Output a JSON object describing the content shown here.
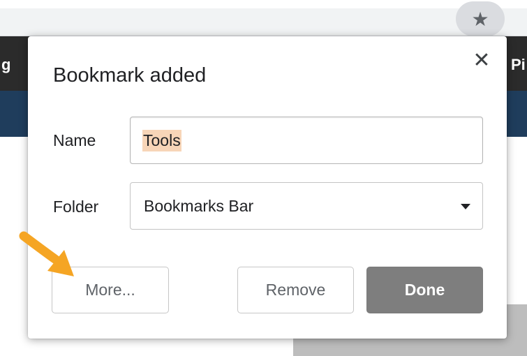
{
  "browser": {
    "bookmarks_bar_left_fragment": "g",
    "bookmarks_bar_right_fragment": "Pi",
    "star_icon": "star-icon"
  },
  "dialog": {
    "title": "Bookmark added",
    "close_icon": "close-icon",
    "name_label": "Name",
    "name_value": "Tools",
    "folder_label": "Folder",
    "folder_value": "Bookmarks Bar",
    "more_label": "More...",
    "remove_label": "Remove",
    "done_label": "Done"
  },
  "colors": {
    "callout_arrow": "#f5a524",
    "selection_highlight": "#f7d5b8",
    "done_button": "#7e7e7e",
    "bookmarks_bar": "#2b2b2b",
    "page_header": "#1f3d5c"
  }
}
